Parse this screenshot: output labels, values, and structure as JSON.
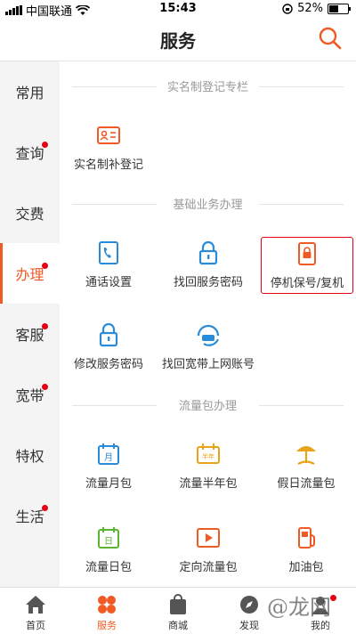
{
  "status_bar": {
    "carrier": "中国联通",
    "time": "15:43",
    "battery": "52%"
  },
  "header": {
    "title": "服务"
  },
  "sidebar": {
    "items": [
      {
        "label": "常用",
        "dot": false,
        "active": false
      },
      {
        "label": "查询",
        "dot": true,
        "active": false
      },
      {
        "label": "交费",
        "dot": false,
        "active": false
      },
      {
        "label": "办理",
        "dot": true,
        "active": true
      },
      {
        "label": "客服",
        "dot": true,
        "active": false
      },
      {
        "label": "宽带",
        "dot": true,
        "active": false
      },
      {
        "label": "特权",
        "dot": false,
        "active": false
      },
      {
        "label": "生活",
        "dot": true,
        "active": false
      }
    ]
  },
  "sections": {
    "realname": {
      "title": "实名制登记专栏",
      "items": [
        {
          "label": "实名制补登记",
          "icon": "id-card-icon",
          "color": "#f05a24"
        }
      ]
    },
    "basic": {
      "title": "基础业务办理",
      "items": [
        {
          "label": "通话设置",
          "icon": "phone-settings-icon",
          "color": "#2a8bd8"
        },
        {
          "label": "找回服务密码",
          "icon": "lock-icon",
          "color": "#2a8bd8"
        },
        {
          "label": "停机保号/复机",
          "icon": "phone-lock-icon",
          "color": "#f05a24"
        },
        {
          "label": "修改服务密码",
          "icon": "lock-edit-icon",
          "color": "#2a8bd8"
        },
        {
          "label": "找回宽带上网账号",
          "icon": "broadband-icon",
          "color": "#2a8bd8"
        }
      ]
    },
    "data_pack": {
      "title": "流量包办理",
      "items": [
        {
          "label": "流量月包",
          "icon": "calendar-month-icon",
          "color": "#2a8bd8",
          "glyph": "月"
        },
        {
          "label": "流量半年包",
          "icon": "calendar-halfyear-icon",
          "color": "#e8a317",
          "glyph": "半年"
        },
        {
          "label": "假日流量包",
          "icon": "beach-icon",
          "color": "#e8a317"
        },
        {
          "label": "流量日包",
          "icon": "calendar-day-icon",
          "color": "#5bb531",
          "glyph": "日"
        },
        {
          "label": "定向流量包",
          "icon": "play-icon",
          "color": "#f05a24"
        },
        {
          "label": "加油包",
          "icon": "fuel-icon",
          "color": "#f05a24"
        }
      ]
    }
  },
  "tabbar": {
    "items": [
      {
        "label": "首页",
        "icon": "home-icon"
      },
      {
        "label": "服务",
        "icon": "service-icon",
        "active": true
      },
      {
        "label": "商城",
        "icon": "shop-bag-icon"
      },
      {
        "label": "发现",
        "icon": "discover-icon"
      },
      {
        "label": "我的",
        "icon": "profile-icon",
        "dot": true
      }
    ]
  },
  "watermark": "@龙网",
  "colors": {
    "accent": "#f05a24",
    "blue": "#2a8bd8",
    "badge": "#e50012"
  }
}
